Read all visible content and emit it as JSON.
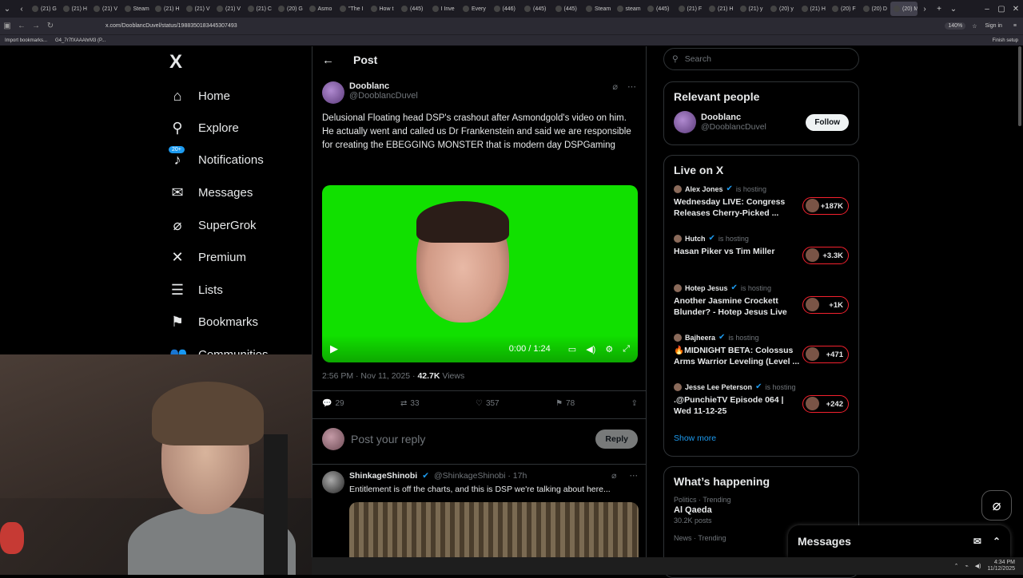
{
  "browser": {
    "tabs": [
      "(21) G",
      "(21) H",
      "(21) V",
      "Steam",
      "(21) H",
      "(21) V",
      "(21) V",
      "(21) C",
      "(20) G",
      "Asmo",
      "\"The I",
      "How t",
      "(445)",
      "I Inve",
      "Every",
      "(446)",
      "(445)",
      "(445)",
      "Steam",
      "steam",
      "(445)",
      "(21) F",
      "(21) H",
      "(21) y",
      "(20) y",
      "(21) H",
      "(20) F",
      "(20) D",
      "(20) M"
    ],
    "url": "x.com/DooblancDuvel/status/1988350183445307493",
    "zoom": "140%",
    "sign_in": "Sign in",
    "bookmarks": [
      "Import bookmarks...",
      "G4_7r7fXAAAhrM3 (P..."
    ],
    "finish_setup": "Finish setup"
  },
  "nav": {
    "logo": "X",
    "items": [
      {
        "label": "Home",
        "icon": "home-icon"
      },
      {
        "label": "Explore",
        "icon": "search-icon"
      },
      {
        "label": "Notifications",
        "icon": "bell-icon",
        "badge": "20+"
      },
      {
        "label": "Messages",
        "icon": "mail-icon"
      },
      {
        "label": "SuperGrok",
        "icon": "grok-icon"
      },
      {
        "label": "Premium",
        "icon": "x-icon"
      },
      {
        "label": "Lists",
        "icon": "list-icon"
      },
      {
        "label": "Bookmarks",
        "icon": "bookmark-icon"
      },
      {
        "label": "Communities",
        "icon": "communities-icon"
      }
    ]
  },
  "post": {
    "header_title": "Post",
    "author_name": "Dooblanc",
    "author_handle": "@DooblancDuvel",
    "text_line1": "Delusional Floating head DSP's crashout after Asmondgold's video on him.",
    "text_line2": "He actually went and called us Dr Frankenstein and said we are responsible for creating the EBEGGING MONSTER that is modern day DSPGaming",
    "video_time": "0:00 / 1:24",
    "timestamp": "2:56 PM · Nov 11, 2025 · ",
    "views_count": "42.7K",
    "views_label": " Views",
    "replies": "29",
    "reposts": "33",
    "likes": "357",
    "bookmarks": "78",
    "reply_placeholder": "Post your reply",
    "reply_button": "Reply"
  },
  "reply": {
    "name": "ShinkageShinobi",
    "handle": "@ShinkageShinobi · 17h",
    "text": "Entitlement is off the charts, and this is DSP we're talking about here..."
  },
  "right": {
    "search_placeholder": "Search",
    "relevant_title": "Relevant people",
    "relevant_name": "Dooblanc",
    "relevant_handle": "@DooblancDuvel",
    "follow": "Follow",
    "live_title": "Live on X",
    "hosting_label": "is hosting",
    "live": [
      {
        "host": "Alex Jones",
        "title": "Wednesday LIVE: Congress Releases Cherry-Picked ...",
        "count": "+187K"
      },
      {
        "host": "Hutch",
        "title": "Hasan Piker vs Tim Miller",
        "count": "+3.3K"
      },
      {
        "host": "Hotep Jesus",
        "title": "Another Jasmine Crockett Blunder? - Hotep Jesus Live",
        "count": "+1K"
      },
      {
        "host": "Bajheera",
        "title": "🔥MIDNIGHT BETA: Colossus Arms Warrior Leveling (Level ...",
        "count": "+471"
      },
      {
        "host": "Jesse Lee Peterson",
        "title": ".@PunchieTV Episode 064 | Wed 11-12-25",
        "count": "+242"
      }
    ],
    "show_more": "Show more",
    "happening_title": "What’s happening",
    "trends": [
      {
        "category": "Politics · Trending",
        "name": "Al Qaeda",
        "posts": "30.2K posts"
      },
      {
        "category": "News · Trending",
        "name": "",
        "posts": ""
      }
    ]
  },
  "messages": {
    "label": "Messages"
  },
  "taskbar": {
    "time": "4:34 PM",
    "date": "11/12/2025"
  },
  "colors": {
    "accent": "#1d9bf0",
    "live_ring": "#f4212e",
    "video_bg": "#11e000"
  }
}
